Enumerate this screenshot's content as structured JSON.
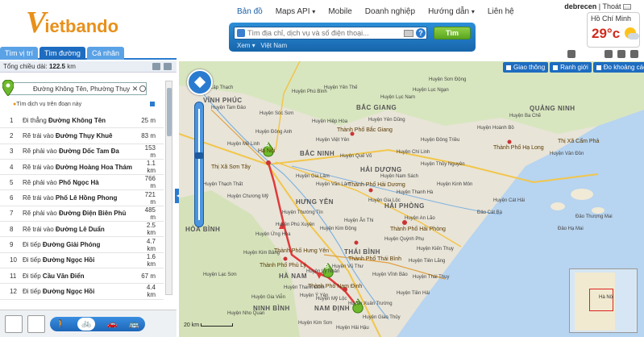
{
  "brand": {
    "logo_v": "V",
    "logo_rest": "ietbando"
  },
  "nav": [
    {
      "label": "Bản đồ",
      "active": true
    },
    {
      "label": "Maps API",
      "caret": "▾"
    },
    {
      "label": "Mobile"
    },
    {
      "label": "Doanh nghiệp"
    },
    {
      "label": "Hướng dẫn",
      "caret": "▾"
    },
    {
      "label": "Liên hệ"
    }
  ],
  "user": {
    "name": "debrecen",
    "sep": "|",
    "logout": "Thoát"
  },
  "search": {
    "placeholder": "Tìm địa chỉ, dịch vụ và số điện thoại...",
    "button": "Tìm",
    "sub_label": "Xem",
    "sub_value": "Việt Nam",
    "help": "?"
  },
  "weather": {
    "city": "Hồ Chí Minh",
    "temp": "29°c"
  },
  "left_tabs": [
    "Tìm vị trí",
    "Tìm đường",
    "Cá nhân"
  ],
  "summary": {
    "label": "Tổng chiều dài:",
    "value": "122.5",
    "unit": "km"
  },
  "route_input": {
    "value": "Đường Không Tên, Phường Thụy Kh",
    "clear": "✕"
  },
  "route_hint": "Tìm dịch vụ trên đoạn này",
  "steps": [
    {
      "n": "1",
      "action": "Đi thẳng",
      "road": "Đường Không Tên",
      "dist": "25 m"
    },
    {
      "n": "2",
      "action": "Rẽ trái vào",
      "road": "Đường Thụy Khuê",
      "dist": "83 m"
    },
    {
      "n": "3",
      "action": "Rẽ phải vào",
      "road": "Đường Dốc Tam Đa",
      "dist": "153 m"
    },
    {
      "n": "4",
      "action": "Rẽ trái vào",
      "road": "Đường Hoàng Hoa Thám",
      "dist": "1.1 km"
    },
    {
      "n": "5",
      "action": "Rẽ phải vào",
      "road": "Phố Ngọc Hà",
      "dist": "766 m"
    },
    {
      "n": "6",
      "action": "Rẽ trái vào",
      "road": "Phố Lê Hồng Phong",
      "dist": "721 m"
    },
    {
      "n": "7",
      "action": "Rẽ phải vào",
      "road": "Đường Điện Biên Phủ",
      "dist": "485 m"
    },
    {
      "n": "8",
      "action": "Rẽ trái vào",
      "road": "Đường Lê Duẩn",
      "dist": "2.5 km"
    },
    {
      "n": "9",
      "action": "Đi tiếp",
      "road": "Đường Giải Phóng",
      "dist": "4.7 km"
    },
    {
      "n": "10",
      "action": "Đi tiếp",
      "road": "Đường Ngọc Hồi",
      "dist": "1.6 km"
    },
    {
      "n": "11",
      "action": "Đi tiếp",
      "road": "Cầu Văn Điển",
      "dist": "67 m"
    },
    {
      "n": "12",
      "action": "Đi tiếp",
      "road": "Đường Ngọc Hồi",
      "dist": "4.4 km"
    }
  ],
  "layers": [
    "Giao thông",
    "Ranh giới",
    "Đo khoảng cách"
  ],
  "map_labels": {
    "prov": [
      "VĨNH PHÚC",
      "BẮC GIANG",
      "QUẢNG NINH",
      "BẮC NINH",
      "HẢI DƯƠNG",
      "HƯNG YÊN",
      "HẢI PHÒNG",
      "HÒA BÌNH",
      "THÁI BÌNH",
      "HÀ NAM",
      "NINH BÌNH",
      "NAM ĐỊNH"
    ],
    "cities": [
      "Hà Nội",
      "Thành Phố Hải Phòng",
      "Thành Phố Nam Định",
      "Thành Phố Hạ Long",
      "Thành Phố Thái Bình",
      "Thành Phố Bắc Giang",
      "Thành Phố Hải Dương",
      "Thành Phố Hưng Yên",
      "Thị Xã Cẩm Phả",
      "Thị Xã Sơn Tây",
      "Thành Phố Phủ Lý"
    ],
    "small": [
      "Huyện Sơn Động",
      "Huyện Lục Ngạn",
      "Huyện Lục Nam",
      "Huyện Yên Dũng",
      "Huyện Đông Triều",
      "Huyện Thủy Nguyên",
      "Huyện Tiên Lãng",
      "Huyện Vĩnh Bảo",
      "Huyện Gia Lộc",
      "Huyện Kim Bảng",
      "Huyện Lạc Sơn",
      "Huyện Kim Sơn",
      "Huyện Giao Thủy",
      "Huyện Hải Hậu",
      "Huyện Tam Đảo",
      "Huyện Mê Linh",
      "Huyện Thạch Thất",
      "Huyện Chương Mỹ",
      "Huyện Ứng Hòa",
      "Huyện Vân Đồn",
      "Huyện Cát Hải",
      "Đảo Cát Bà",
      "Đảo Thượng Mai",
      "Đảo Hạ Mai",
      "Huyện Hoành Bồ",
      "Huyện Ba Chẽ",
      "Huyện Yên Thế",
      "Huyện Lập Thạch",
      "Huyện Kinh Môn",
      "Huyện Quỳnh Phụ",
      "Huyện Thái Thụy",
      "Huyện Tiền Hải",
      "Huyện Vũ Thư",
      "Huyện Xuân Trường",
      "Huyện Mỹ Lộc",
      "Huyện Ý Yên",
      "Huyện Gia Viễn",
      "Huyện Nho Quan",
      "Huyện Thanh Liêm",
      "Huyện Lý Nhân",
      "Huyện Phú Xuyên",
      "Huyện Thường Tín",
      "Huyện Kim Động",
      "Huyện Ân Thi",
      "Huyện Văn Lâm",
      "Huyện Gia Lâm",
      "Huyện Đông Anh",
      "Huyện Sóc Sơn",
      "Huyện Phú Bình",
      "Huyện Hiệp Hòa",
      "Huyện Việt Yên",
      "Huyện Quế Võ",
      "Huyện Chí Linh",
      "Huyện Nam Sách",
      "Huyện Thanh Hà",
      "Huyện An Lão",
      "Huyện Kiến Thụy"
    ]
  },
  "markers": {
    "a": "A",
    "b": "B",
    "c": "C"
  },
  "minimap_label": "Hà Nội",
  "scale": "20 km",
  "colors": {
    "brand": "#e8901a",
    "accent": "#1d6cc0",
    "route": "#e03a3a",
    "search_btn": "#6cb82a"
  }
}
